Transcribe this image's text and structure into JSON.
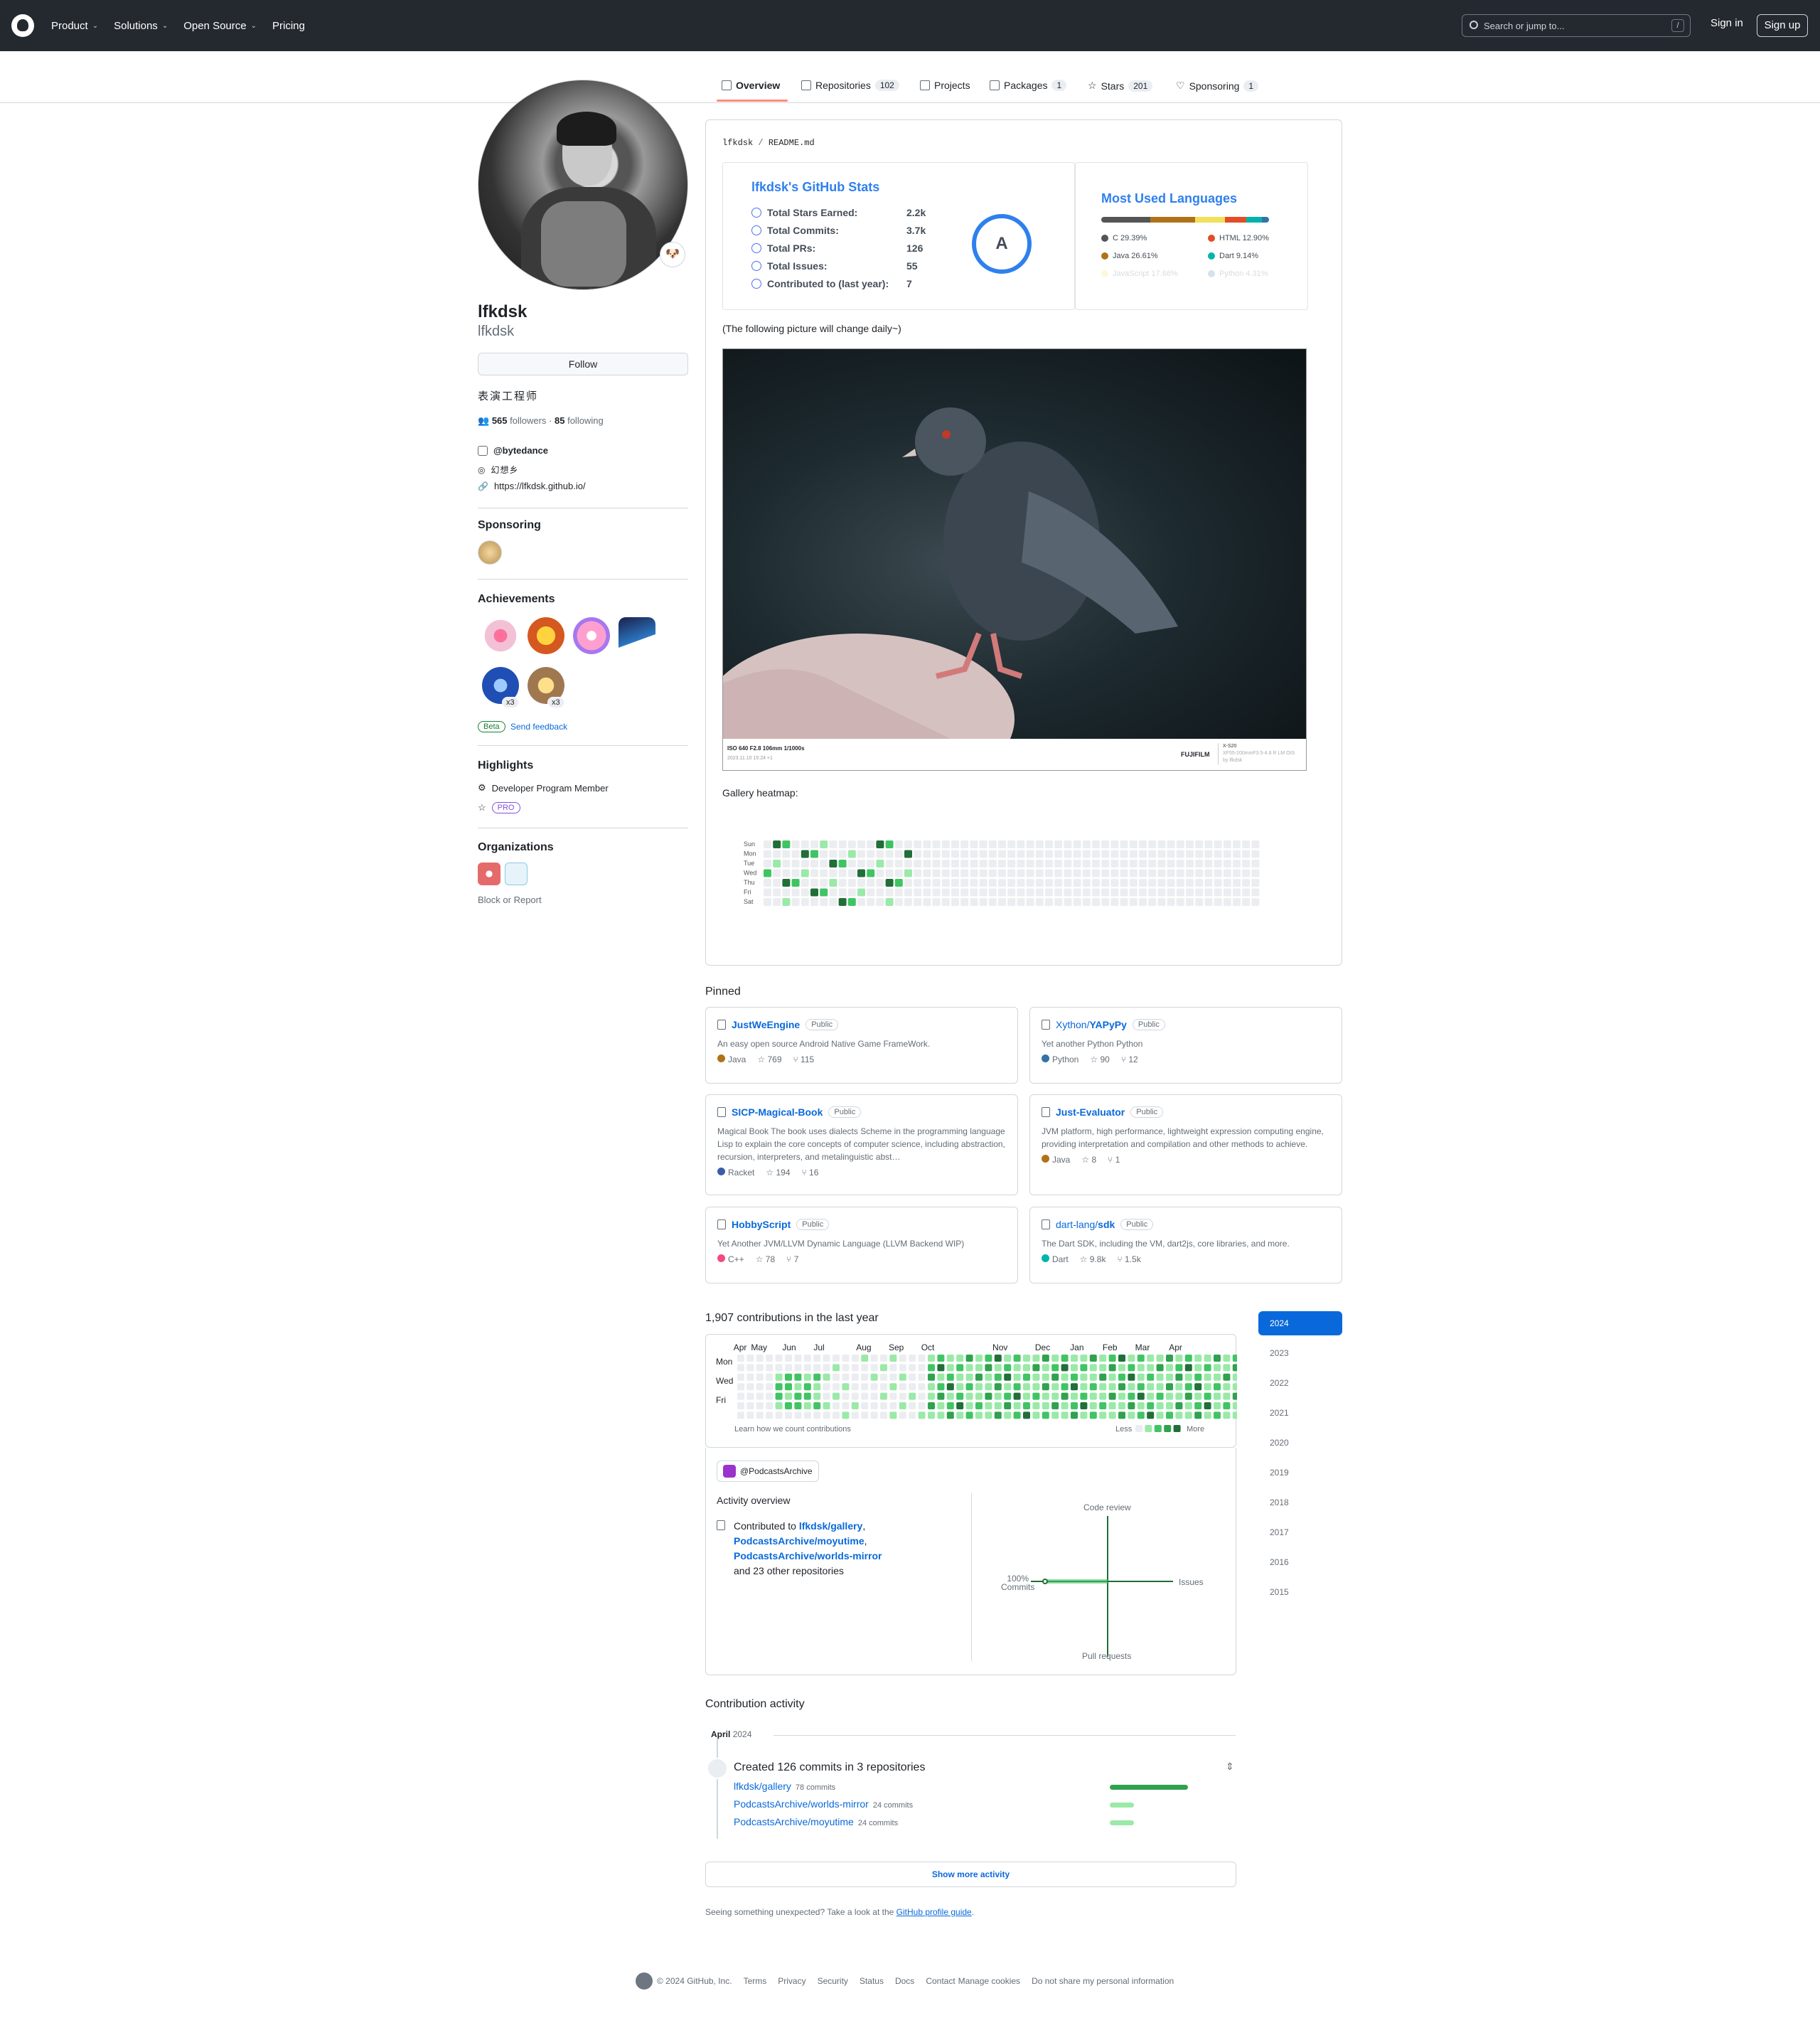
{
  "header": {
    "nav": [
      "Product",
      "Solutions",
      "Open Source",
      "Pricing"
    ],
    "search_placeholder": "Search or jump to...",
    "search_key": "/",
    "sign_in": "Sign in",
    "sign_up": "Sign up"
  },
  "tabs": [
    {
      "label": "Overview",
      "count": ""
    },
    {
      "label": "Repositories",
      "count": "102"
    },
    {
      "label": "Projects",
      "count": ""
    },
    {
      "label": "Packages",
      "count": "1"
    },
    {
      "label": "Stars",
      "count": "201"
    },
    {
      "label": "Sponsoring",
      "count": "1"
    }
  ],
  "profile": {
    "name": "lfkdsk",
    "login": "lfkdsk",
    "status_emoji": "🐶",
    "follow": "Follow",
    "bio": "表演工程师",
    "followers_count": "565",
    "followers_label": "followers",
    "following_count": "85",
    "following_label": "following",
    "company": "@bytedance",
    "location": "幻想乡",
    "website": "https://lfkdsk.github.io/",
    "sponsoring_title": "Sponsoring",
    "achievements_title": "Achievements",
    "achievement_multipliers": [
      "x3",
      "x3"
    ],
    "beta": "Beta",
    "send_feedback": "Send feedback",
    "highlights_title": "Highlights",
    "highlight_1": "Developer Program Member",
    "highlight_2": "PRO",
    "organizations_title": "Organizations",
    "block": "Block or Report"
  },
  "readme": {
    "path_user": "lfkdsk",
    "path_sep": " / ",
    "path_file": "README.md",
    "stats_title": "lfkdsk's GitHub Stats",
    "stats": [
      {
        "label": "Total Stars Earned:",
        "value": "2.2k"
      },
      {
        "label": "Total Commits:",
        "value": "3.7k"
      },
      {
        "label": "Total PRs:",
        "value": "126"
      },
      {
        "label": "Total Issues:",
        "value": "55"
      },
      {
        "label": "Contributed to (last year):",
        "value": "7"
      }
    ],
    "rank": "A",
    "langs_title": "Most Used Languages",
    "langs": [
      {
        "name": "C 29.39%",
        "color": "#555555",
        "pct": 29.39
      },
      {
        "name": "Java 26.61%",
        "color": "#b07219",
        "pct": 26.61
      },
      {
        "name": "JavaScript 17.66%",
        "color": "#f1e05a",
        "pct": 17.66
      },
      {
        "name": "HTML 12.90%",
        "color": "#e34c26",
        "pct": 12.9
      },
      {
        "name": "Dart 9.14%",
        "color": "#00b4ab",
        "pct": 9.14
      },
      {
        "name": "Python 4.31%",
        "color": "#3572A5",
        "pct": 4.31
      }
    ],
    "daily_note": "(The following picture will change daily~)",
    "exif_1": "ISO 640 F2.8 106mm 1/1000s",
    "exif_2": "2023.11.10 15:24 +1",
    "exif_brand": "FUJIFILM",
    "exif_model": "X-S20",
    "exif_lens": "XF55-200mmF3.5-4.8 R LM OIS",
    "exif_user": "by lfkdsk",
    "heatmap_title": "Gallery heatmap:",
    "heatmap_days": [
      "Sun",
      "Mon",
      "Tue",
      "Wed",
      "Thu",
      "Fri",
      "Sat"
    ]
  },
  "pinned": {
    "title": "Pinned",
    "items": [
      {
        "owner": "",
        "name": "JustWeEngine",
        "badge": "Public",
        "desc": "An easy open source Android Native Game FrameWork.",
        "lang": "Java",
        "lang_color": "#b07219",
        "stars": "769",
        "forks": "115"
      },
      {
        "owner": "Xython/",
        "name": "YAPyPy",
        "badge": "Public",
        "desc": "Yet another Python Python",
        "lang": "Python",
        "lang_color": "#3572A5",
        "stars": "90",
        "forks": "12"
      },
      {
        "owner": "",
        "name": "SICP-Magical-Book",
        "badge": "Public",
        "desc": "Magical Book The book uses dialects Scheme in the programming language Lisp to explain the core concepts of computer science, including abstraction, recursion, interpreters, and metalinguistic abst…",
        "lang": "Racket",
        "lang_color": "#3c5caa",
        "stars": "194",
        "forks": "16"
      },
      {
        "owner": "",
        "name": "Just-Evaluator",
        "badge": "Public",
        "desc": "JVM platform, high performance, lightweight expression computing engine, providing interpretation and compilation and other methods to achieve.",
        "lang": "Java",
        "lang_color": "#b07219",
        "stars": "8",
        "forks": "1"
      },
      {
        "owner": "",
        "name": "HobbyScript",
        "badge": "Public",
        "desc": "Yet Another JVM/LLVM Dynamic Language (LLVM Backend WIP)",
        "lang": "C++",
        "lang_color": "#f34b7d",
        "stars": "78",
        "forks": "7"
      },
      {
        "owner": "dart-lang/",
        "name": "sdk",
        "badge": "Public",
        "desc": "The Dart SDK, including the VM, dart2js, core libraries, and more.",
        "lang": "Dart",
        "lang_color": "#00B4AB",
        "stars": "9.8k",
        "forks": "1.5k"
      }
    ]
  },
  "contributions": {
    "title": "1,907 contributions in the last year",
    "months": [
      "Apr",
      "May",
      "Jun",
      "Jul",
      "Aug",
      "Sep",
      "Oct",
      "Nov",
      "Dec",
      "Jan",
      "Feb",
      "Mar",
      "Apr"
    ],
    "days": [
      "Mon",
      "Wed",
      "Fri"
    ],
    "learn": "Learn how we count contributions",
    "less": "Less",
    "more": "More",
    "years": [
      "2024",
      "2023",
      "2022",
      "2021",
      "2020",
      "2019",
      "2018",
      "2017",
      "2016",
      "2015"
    ],
    "org_filter": "@PodcastsArchive",
    "activity_overview": "Activity overview",
    "contributed_to": "Contributed to",
    "repo_1": "lfkdsk/gallery",
    "repo_2": "PodcastsArchive/moyutime",
    "repo_3": "PodcastsArchive/worlds-mirror",
    "other_repos": "and 23 other repositories",
    "chart_code_review": "Code review",
    "chart_issues": "Issues",
    "chart_pull_requests": "Pull requests",
    "chart_commits_pct": "100%",
    "chart_commits": "Commits"
  },
  "activity": {
    "title": "Contribution activity",
    "month": "April",
    "year": "2024",
    "created": "Created 126 commits in 3 repositories",
    "repos": [
      {
        "name": "lfkdsk/gallery",
        "commits": "78 commits",
        "share": 1.0
      },
      {
        "name": "PodcastsArchive/worlds-mirror",
        "commits": "24 commits",
        "share": 0.31
      },
      {
        "name": "PodcastsArchive/moyutime",
        "commits": "24 commits",
        "share": 0.31
      }
    ],
    "show_more": "Show more activity",
    "unexpected": "Seeing something unexpected? Take a look at the",
    "guide": "GitHub profile guide",
    "guide_end": "."
  },
  "footer": {
    "copyright": "© 2024 GitHub, Inc.",
    "links": [
      "Terms",
      "Privacy",
      "Security",
      "Status",
      "Docs",
      "Contact",
      "Manage cookies",
      "Do not share my personal information"
    ]
  },
  "colors": {
    "accent": "#0969da",
    "green_1": "#9be9a8",
    "green_2": "#40c463",
    "green_3": "#30a14e",
    "green_4": "#216e39",
    "empty": "#ebedf0"
  }
}
